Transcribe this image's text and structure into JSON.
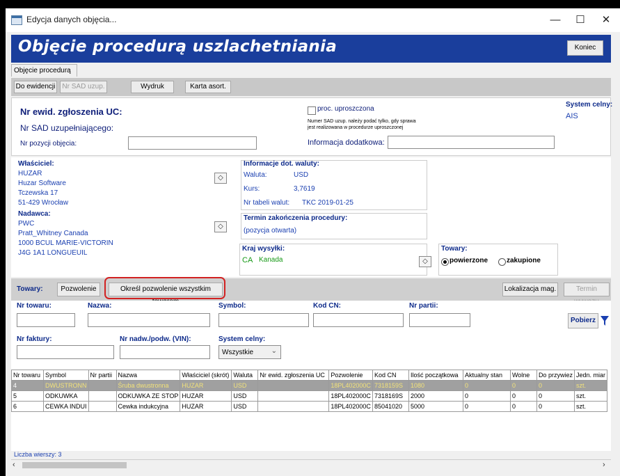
{
  "window": {
    "title": "Edycja danych objęcia...",
    "minimize": "—",
    "maximize": "☐",
    "close": "✕"
  },
  "header": {
    "title": "Objęcie procedurą uszlachetniania",
    "close_label": "Koniec"
  },
  "tabs": [
    {
      "label": "Objęcie procedurą"
    }
  ],
  "toolbar": {
    "buttons": [
      "Do ewidencji",
      "Nr SAD uzup.",
      "Wydruk",
      "Karta asort."
    ]
  },
  "ewid": {
    "title": "Nr ewid. zgłoszenia UC:",
    "sad_label": "Nr SAD uzupełniającego:",
    "pozycja_label": "Nr pozycji objęcia:",
    "pozycja_value": "",
    "proc_label": "proc. uproszczona",
    "note_line1": "Numer SAD uzup. należy podać tylko, gdy sprawa",
    "note_line2": "jest realizowana w procedurze uproszczonej",
    "info_label": "Informacja dodatkowa:",
    "info_value": "",
    "system_label": "System celny:",
    "system_value": "AIS"
  },
  "wlasciciel": {
    "label": "Właściciel:",
    "lines": [
      "HUZAR",
      "Huzar Software",
      "Tczewska 17",
      "51-429 Wrocław"
    ]
  },
  "nadawca": {
    "label": "Nadawca:",
    "lines": [
      "PWC",
      "Pratt_Whitney Canada",
      "1000 BCUL MARIE-VICTORIN",
      "J4G 1A1 LONGUEUIL"
    ]
  },
  "waluta": {
    "label": "Informacje dot. waluty:",
    "waluta_label": "Waluta:",
    "waluta_value": "USD",
    "kurs_label": "Kurs:",
    "kurs_value": "3,7619",
    "tabela_label": "Nr tabeli walut:",
    "tabela_value": "TKC 2019-01-25"
  },
  "termin": {
    "label": "Termin zakończenia procedury:",
    "value": "(pozycja otwarta)"
  },
  "kraj": {
    "label": "Kraj wysyłki:",
    "code": "CA",
    "name": "Kanada"
  },
  "towary_radio": {
    "label": "Towary:",
    "options": [
      "powierzone",
      "zakupione"
    ],
    "selected": "powierzone"
  },
  "towary_bar": {
    "label": "Towary:",
    "pozwolenie": "Pozwolenie",
    "okresl": "Określ pozwolenie wszystkim towarom",
    "lokalizacja": "Lokalizacja mag.",
    "termin": "Termin wywozu"
  },
  "filters": {
    "nr_towaru": "Nr towaru:",
    "nazwa": "Nazwa:",
    "symbol": "Symbol:",
    "kod_cn": "Kod CN:",
    "nr_partii": "Nr partii:",
    "nr_faktury": "Nr faktury:",
    "nr_nadw": "Nr nadw./podw. (VIN):",
    "system": "System celny:",
    "system_value": "Wszystkie",
    "pobierz": "Pobierz"
  },
  "table": {
    "columns": [
      "Nr towaru",
      "Symbol",
      "Nr partii",
      "Nazwa",
      "Właściciel (skrót)",
      "Waluta",
      "Nr ewid. zgłoszenia UC",
      "Pozwolenie",
      "Kod CN",
      "Ilość początkowa",
      "Aktualny stan",
      "Wolne",
      "Do przywiez",
      "Jedn. miar"
    ],
    "rows": [
      [
        "4",
        "DWUSTRONN",
        "",
        "Śruba dwustronna",
        "HUZAR",
        "USD",
        "",
        "18PL402000C",
        "7318159S",
        "1080",
        "0",
        "0",
        "0",
        "szt."
      ],
      [
        "5",
        "ODKUWKA",
        "",
        "ODKUWKA ZE STOP",
        "HUZAR",
        "USD",
        "",
        "18PL402000C",
        "7318169S",
        "2000",
        "0",
        "0",
        "0",
        "szt."
      ],
      [
        "6",
        "CEWKA INDUI",
        "",
        "Cewka indukcyjna",
        "HUZAR",
        "USD",
        "",
        "18PL402000C",
        "85041020",
        "5000",
        "0",
        "0",
        "0",
        "szt."
      ]
    ]
  },
  "footer": {
    "count": "Liczba wierszy: 3"
  },
  "colors": {
    "header": "#1a3e9c",
    "highlight": "#d22222"
  }
}
